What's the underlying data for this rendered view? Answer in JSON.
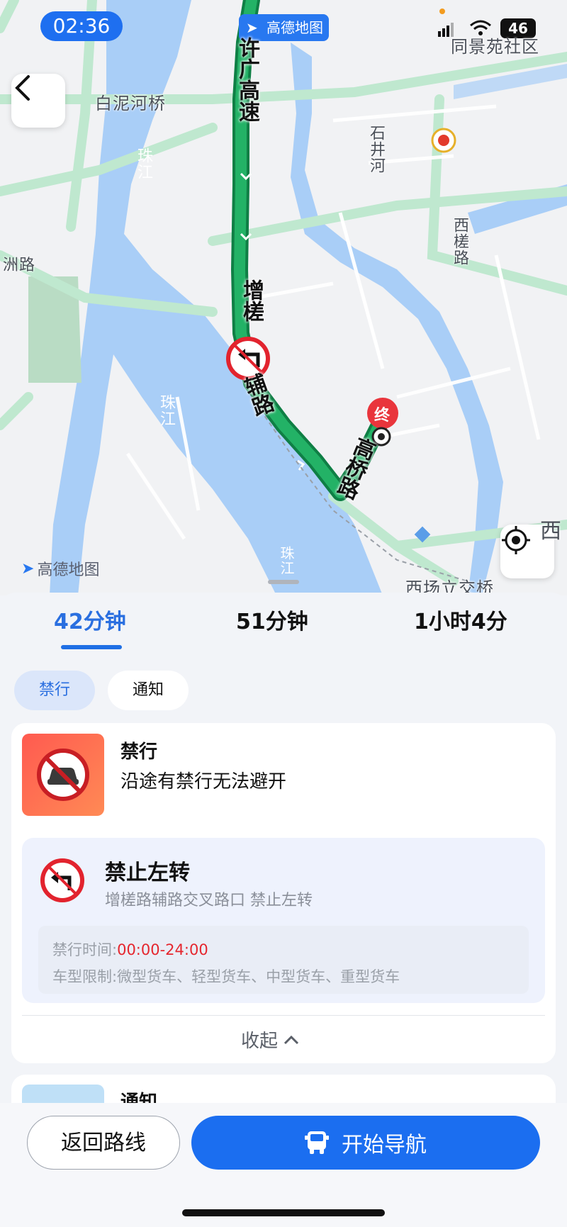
{
  "status_bar": {
    "time": "02:36",
    "battery": "46",
    "brand_badge": "高德地图"
  },
  "map": {
    "labels": {
      "bainihe_bridge": "白泥河桥",
      "tongjingyuan": "同景苑社区",
      "zhujiang_upper": "珠江",
      "zhujiang_lower": "珠江",
      "shijinghe": "石井河",
      "xichang_road": "西槎路",
      "zhouzhou_road": "洲路",
      "xichang_interchange": "西场立交桥",
      "gaode_logo": "高德地图",
      "end_marker": "终",
      "zhujiang_bottom": "珠江",
      "xi_edge": "西"
    },
    "road_labels": {
      "xuguang_expressway": "许广高速",
      "zengcha": "增槎",
      "fulu": "辅路",
      "gaoqiao_road": "高桥路"
    },
    "route_color": "#1aa85c",
    "water_color": "#a9cef7",
    "park_color": "#b9dcc4"
  },
  "tabs": [
    {
      "label": "42分钟",
      "active": true
    },
    {
      "label": "51分钟",
      "active": false
    },
    {
      "label": "1小时4分",
      "active": false
    }
  ],
  "filters": [
    {
      "label": "禁行",
      "active": true
    },
    {
      "label": "通知",
      "active": false
    }
  ],
  "restriction_card": {
    "title": "禁行",
    "description": "沿途有禁行无法避开",
    "item": {
      "title": "禁止左转",
      "location": "增槎路辅路交叉路口 禁止左转",
      "time_label": "禁行时间:",
      "time_value": "00:00-24:00",
      "vehicle_label": "车型限制:",
      "vehicle_value": "微型货车、轻型货车、中型货车、重型货车"
    },
    "collapse_label": "收起"
  },
  "notice_card": {
    "title": "通知"
  },
  "bottom": {
    "back_label": "返回路线",
    "start_label": "开始导航"
  },
  "colors": {
    "accent": "#1b6ef0",
    "danger": "#e2232e",
    "time_red": "#e5262e"
  }
}
